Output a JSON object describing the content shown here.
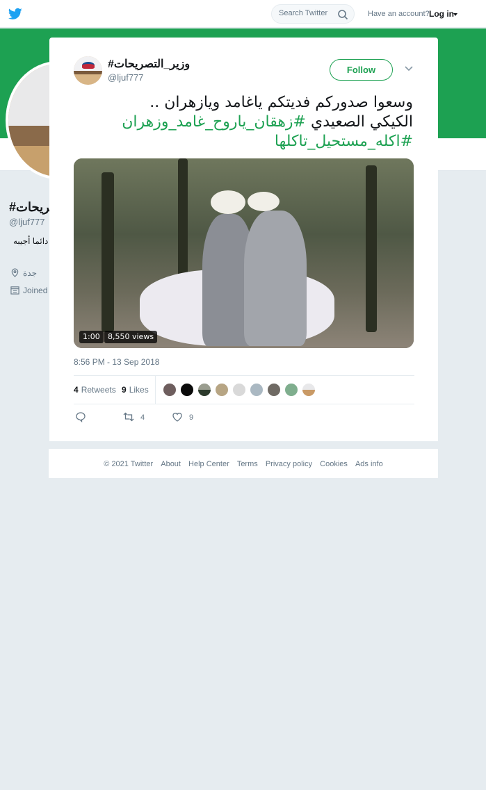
{
  "topbar": {
    "search_placeholder": "Search Twitter",
    "have_account": "Have an account?",
    "login": "Log in"
  },
  "profile_bg": {
    "name": "#وزير_التصريحات",
    "handle": "@ljuf777",
    "bio": "دائما أجيبه",
    "location": "جدة",
    "joined": "Joined"
  },
  "tweet": {
    "author_name": "#وزير_التصريحات",
    "author_handle": "@ljuf777",
    "follow_label": "Follow",
    "text_line1": "وسعوا صدوركم فديتكم ياغامد ويازهران  ..",
    "text_line2_plain": "الكيكي الصعيدي ",
    "text_line2_tag": "#زهقان_ياروح_غامد_وزهران",
    "text_line3_tag": "#اكله_مستحيل_تاكلها",
    "video_duration": "1:00",
    "video_views": "8,550 views",
    "timestamp": "8:56 PM - 13 Sep 2018",
    "retweets_count": "4",
    "retweets_label": "Retweets",
    "likes_count": "9",
    "likes_label": "Likes",
    "action_retweet_count": "4",
    "action_like_count": "9"
  },
  "footer": {
    "copyright": "© 2021 Twitter",
    "about": "About",
    "help": "Help Center",
    "terms": "Terms",
    "privacy": "Privacy policy",
    "cookies": "Cookies",
    "ads": "Ads info"
  },
  "colors": {
    "accent": "#1da152",
    "twitter_blue": "#1da1f2",
    "background": "#e6ecf0"
  }
}
